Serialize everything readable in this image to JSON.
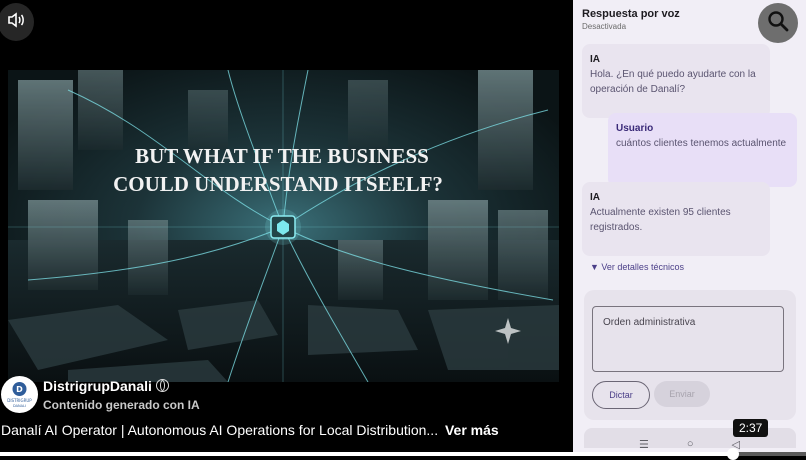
{
  "player": {
    "video_headline_line1": "BUT WHAT IF THE BUSINESS",
    "video_headline_line2": "COULD UNDERSTAND ITSEELF?",
    "mute_icon": "speaker-icon",
    "channel_name": "DistrigrupDanali",
    "channel_badge_icon": "globe-icon",
    "ai_label": "Contenido generado con IA",
    "avatar_text_line1": "DISTRIGRUP",
    "avatar_text_line2": "DANALI",
    "caption": "Danalí AI Operator | Autonomous AI Operations for Local Distribution...",
    "caption_more": "Ver más",
    "time": "2:37",
    "progress_fraction": 0.91
  },
  "phone": {
    "voice_title": "Respuesta por voz",
    "voice_status": "Desactivada",
    "search_icon": "search-icon",
    "messages": [
      {
        "who": "IA",
        "text": "Hola. ¿En qué puedo ayudarte con la operación de Danalí?"
      },
      {
        "who": "Usuario",
        "text": "cuántos clientes tenemos actualmente"
      },
      {
        "who": "IA",
        "text": "Actualmente existen 95 clientes registrados."
      }
    ],
    "details_label": "▼  Ver detalles técnicos",
    "order_placeholder": "Orden administrativa",
    "dictar_label": "Dictar",
    "enviar_label": "Enviar",
    "nav": {
      "menu": "☰",
      "home": "○",
      "back": "◁"
    }
  }
}
